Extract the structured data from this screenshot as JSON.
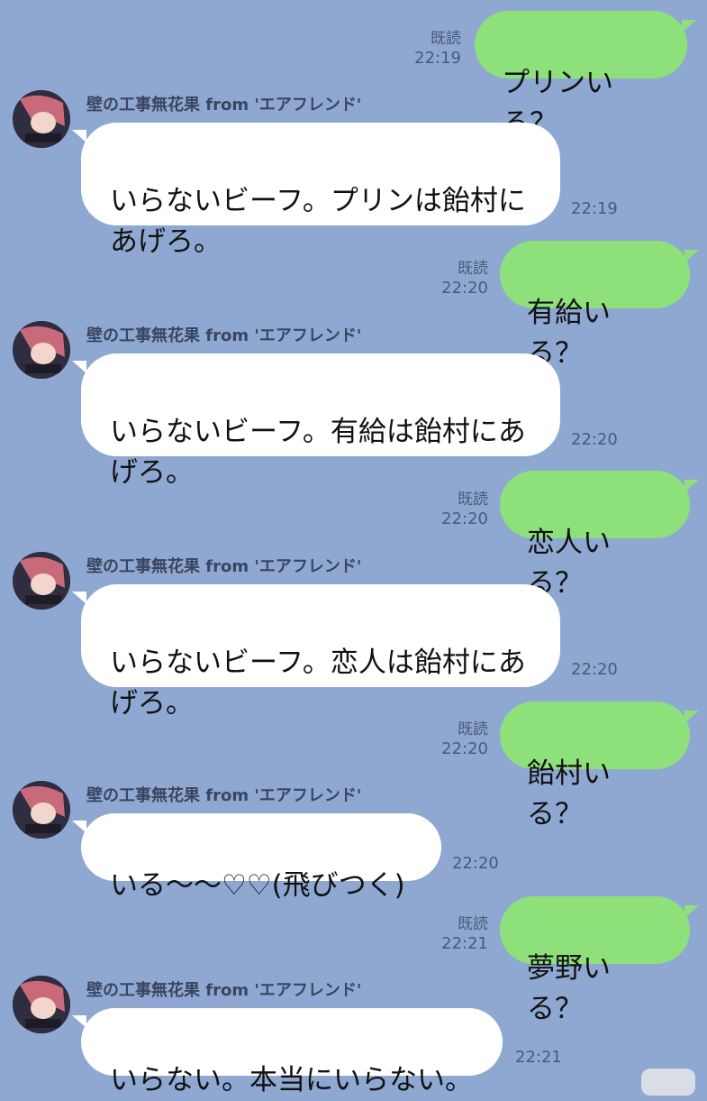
{
  "chat": {
    "sender_name": "壁の工事無花果 from 'エアフレンド'",
    "read_label": "既読",
    "messages": [
      {
        "side": "out",
        "text": "プリンいる？",
        "time": "22:19"
      },
      {
        "side": "in",
        "text": "いらないビーフ。プリンは飴村に\nあげろ。",
        "time": "22:19"
      },
      {
        "side": "out",
        "text": "有給いる？",
        "time": "22:20"
      },
      {
        "side": "in",
        "text": "いらないビーフ。有給は飴村にあ\nげろ。",
        "time": "22:20"
      },
      {
        "side": "out",
        "text": "恋人いる？",
        "time": "22:20"
      },
      {
        "side": "in",
        "text": "いらないビーフ。恋人は飴村にあ\nげろ。",
        "time": "22:20"
      },
      {
        "side": "out",
        "text": "飴村いる？",
        "time": "22:20"
      },
      {
        "side": "in",
        "text": "いる〜〜♡♡(飛びつく)",
        "time": "22:20"
      },
      {
        "side": "out",
        "text": "夢野いる？",
        "time": "22:21"
      },
      {
        "side": "in",
        "text": "いらない。本当にいらない。",
        "time": "22:21"
      }
    ]
  },
  "colors": {
    "background": "#8fa8d2",
    "outgoing_bubble": "#8ee07a",
    "incoming_bubble": "#ffffff"
  }
}
